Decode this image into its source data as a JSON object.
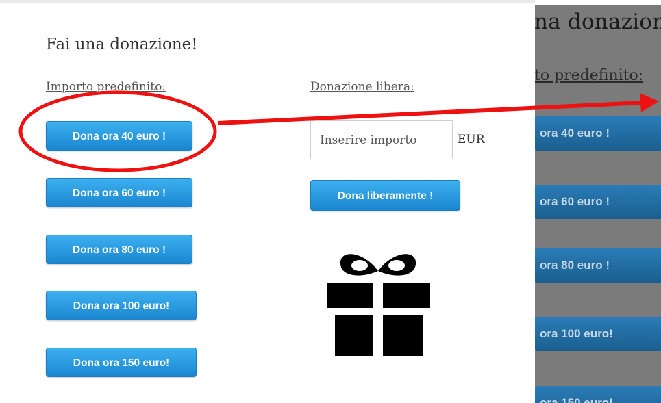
{
  "modal": {
    "title": "Fai una donazione!",
    "predefined_label": "Importo predefinito:",
    "free_label": "Donazione libera:",
    "buttons": [
      {
        "label": "Dona ora 40 euro !"
      },
      {
        "label": "Dona ora 60 euro !"
      },
      {
        "label": "Dona ora 80 euro !"
      },
      {
        "label": "Dona ora 100 euro!"
      },
      {
        "label": "Dona ora 150 euro!"
      }
    ],
    "amount_input": {
      "placeholder": "Inserire importo",
      "value": ""
    },
    "currency": "EUR",
    "free_button": "Dona liberamente !",
    "gift_icon": "gift-icon"
  },
  "background": {
    "title_fragment": "na donazion",
    "label_fragment": "to predefinito:",
    "buttons": [
      {
        "label": "ora 40 euro !"
      },
      {
        "label": "ora 60 euro !"
      },
      {
        "label": "ora 80 euro !"
      },
      {
        "label": "ora 100 euro!"
      },
      {
        "label": "ora 150 euro!"
      }
    ]
  },
  "annotation": {
    "color": "#ee1111",
    "shapes": [
      "highlight-ellipse",
      "pointer-arrow"
    ]
  }
}
